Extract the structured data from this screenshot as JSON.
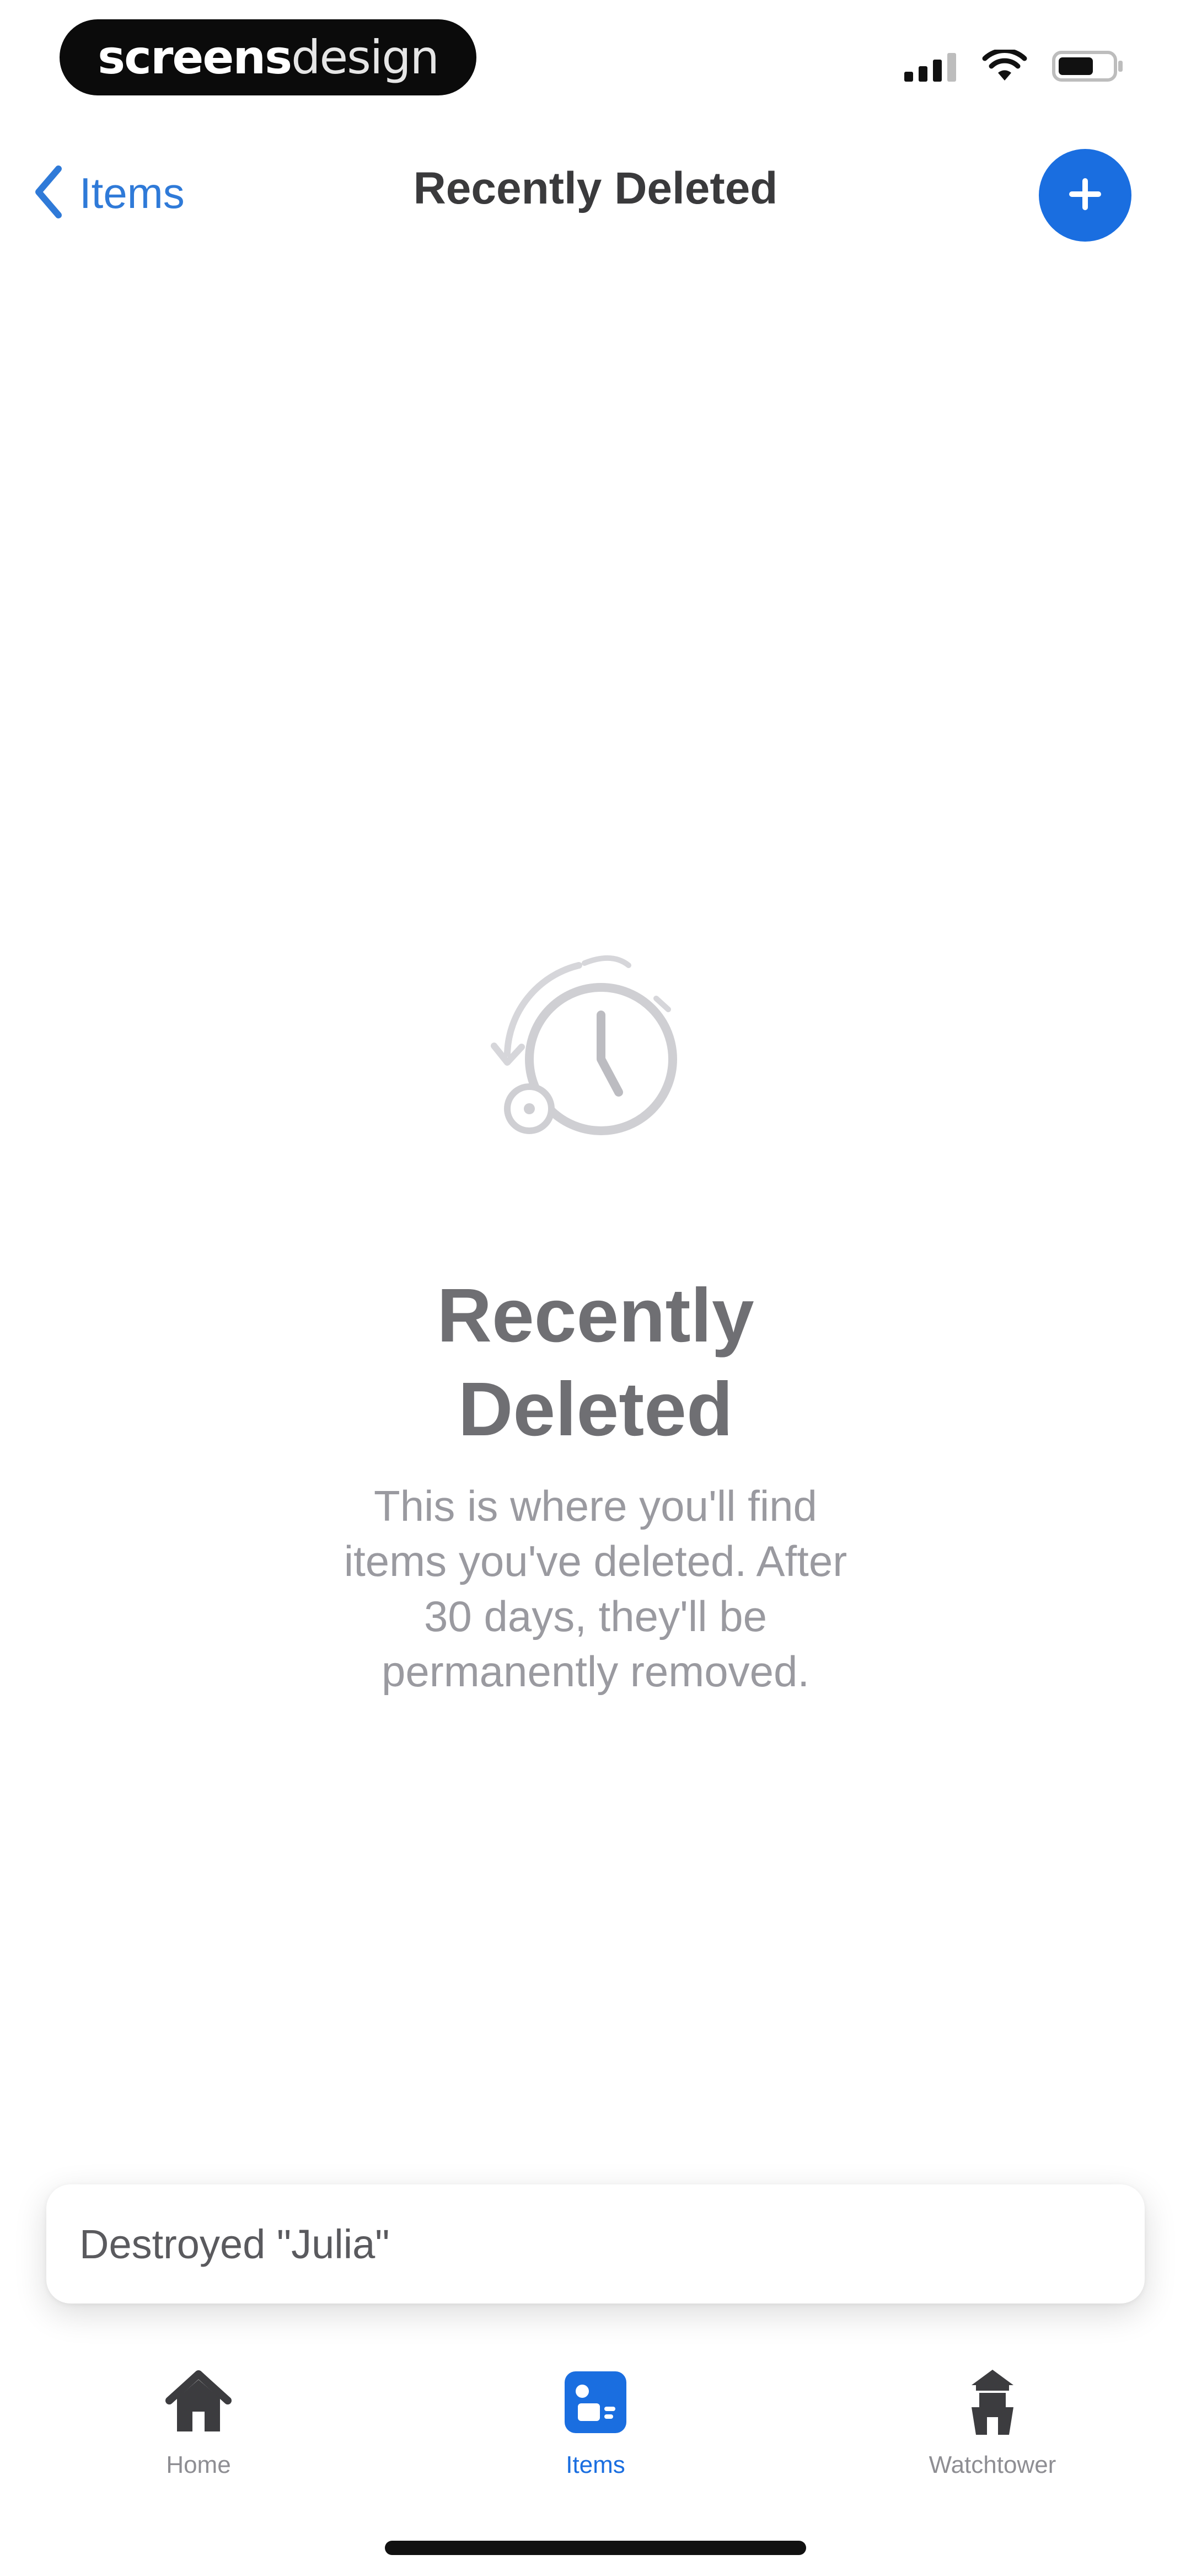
{
  "status_bar": {
    "brand_part1": "screens",
    "brand_part2": "design",
    "icons": [
      "signal-icon",
      "wifi-icon",
      "battery-icon"
    ]
  },
  "nav": {
    "back_label": "Items",
    "title": "Recently Deleted",
    "add_icon": "plus-icon"
  },
  "empty_state": {
    "icon": "restore-clock-icon",
    "title_line1": "Recently",
    "title_line2": "Deleted",
    "body_line1": "This is where you'll find",
    "body_line2": "items you've deleted. After",
    "body_line3": "30 days, they'll be",
    "body_line4": "permanently removed."
  },
  "toast": {
    "message": "Destroyed \"Julia\""
  },
  "tabs": [
    {
      "label": "Home",
      "icon": "home-icon",
      "active": false
    },
    {
      "label": "Items",
      "icon": "items-icon",
      "active": true
    },
    {
      "label": "Watchtower",
      "icon": "watchtower-icon",
      "active": false
    }
  ],
  "colors": {
    "accent": "#1a6ee0",
    "back_link": "#2f7ad8",
    "title_gray": "#6f6f73",
    "body_gray": "#9a9aa0"
  }
}
